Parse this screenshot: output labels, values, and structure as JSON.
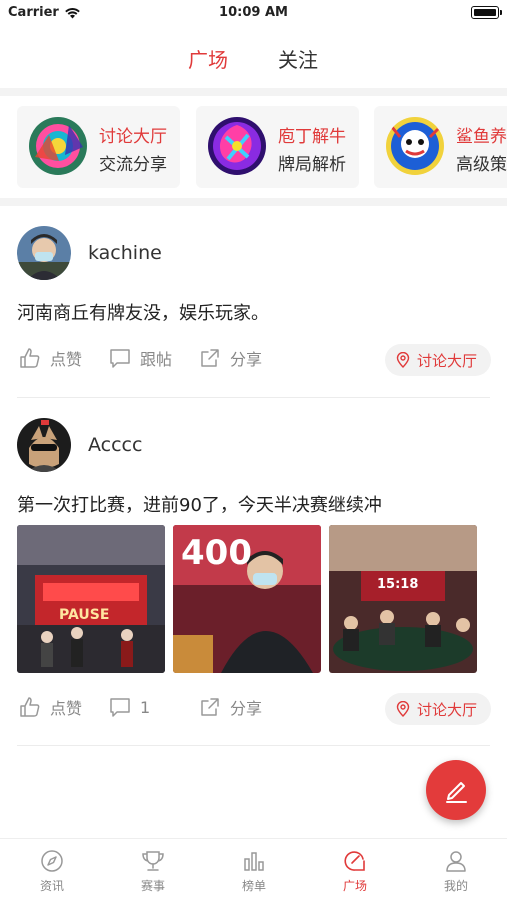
{
  "status": {
    "carrier": "Carrier",
    "time": "10:09 AM"
  },
  "tabs": [
    {
      "label": "广场",
      "active": true
    },
    {
      "label": "关注",
      "active": false
    }
  ],
  "categories": [
    {
      "title": "讨论大厅",
      "subtitle": "交流分享"
    },
    {
      "title": "庖丁解牛",
      "subtitle": "牌局解析"
    },
    {
      "title": "鲨鱼养",
      "subtitle": "高级策"
    }
  ],
  "posts": [
    {
      "username": "kachine",
      "text": "河南商丘有牌友没，娱乐玩家。",
      "like_label": "点赞",
      "comment_label": "跟帖",
      "share_label": "分享",
      "location_tag": "讨论大厅"
    },
    {
      "username": "Acccc",
      "text": "第一次打比赛，进前90了，今天半决赛继续冲",
      "images": [
        {
          "overlay_text": "PAUSE"
        },
        {
          "overlay_text": "400"
        },
        {
          "overlay_text": "15:18"
        }
      ],
      "like_label": "点赞",
      "comment_label": "1",
      "share_label": "分享",
      "location_tag": "讨论大厅"
    }
  ],
  "bottom_nav": [
    {
      "label": "资讯",
      "icon": "compass-icon",
      "active": false
    },
    {
      "label": "赛事",
      "icon": "trophy-icon",
      "active": false
    },
    {
      "label": "榜单",
      "icon": "bar-chart-icon",
      "active": false
    },
    {
      "label": "广场",
      "icon": "square-chat-icon",
      "active": true
    },
    {
      "label": "我的",
      "icon": "user-icon",
      "active": false
    }
  ],
  "colors": {
    "accent": "#e03a3a",
    "muted": "#888888",
    "band": "#f3f3f3"
  }
}
